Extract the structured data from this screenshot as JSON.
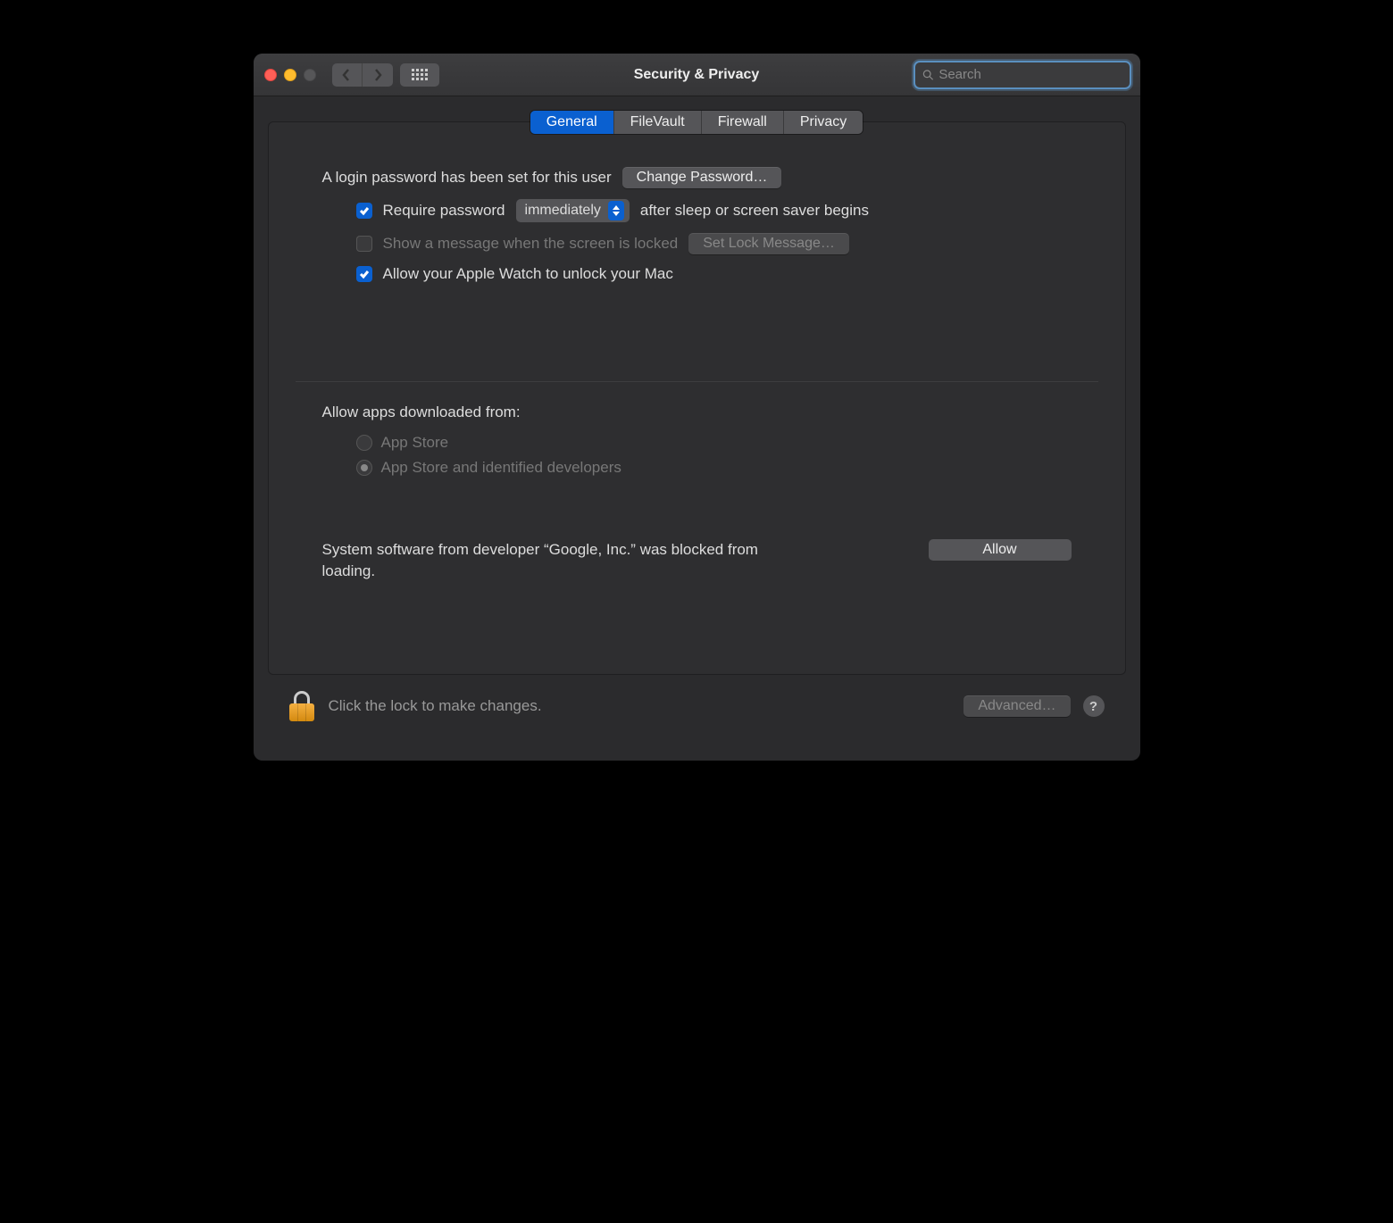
{
  "window": {
    "title": "Security & Privacy"
  },
  "search": {
    "placeholder": "Search"
  },
  "tabs": [
    {
      "label": "General",
      "active": true
    },
    {
      "label": "FileVault",
      "active": false
    },
    {
      "label": "Firewall",
      "active": false
    },
    {
      "label": "Privacy",
      "active": false
    }
  ],
  "general": {
    "login_password_text": "A login password has been set for this user",
    "change_password_button": "Change Password…",
    "require_password_label": "Require password",
    "require_password_delay": "immediately",
    "require_password_suffix": "after sleep or screen saver begins",
    "show_message_label": "Show a message when the screen is locked",
    "set_lock_message_button": "Set Lock Message…",
    "apple_watch_label": "Allow your Apple Watch to unlock your Mac",
    "allow_apps_heading": "Allow apps downloaded from:",
    "radio_options": [
      {
        "label": "App Store",
        "selected": false
      },
      {
        "label": "App Store and identified developers",
        "selected": true
      }
    ],
    "blocked_message": "System software from developer “Google, Inc.” was blocked from loading.",
    "allow_button": "Allow"
  },
  "footer": {
    "lock_text": "Click the lock to make changes.",
    "advanced_button": "Advanced…",
    "help_label": "?"
  }
}
